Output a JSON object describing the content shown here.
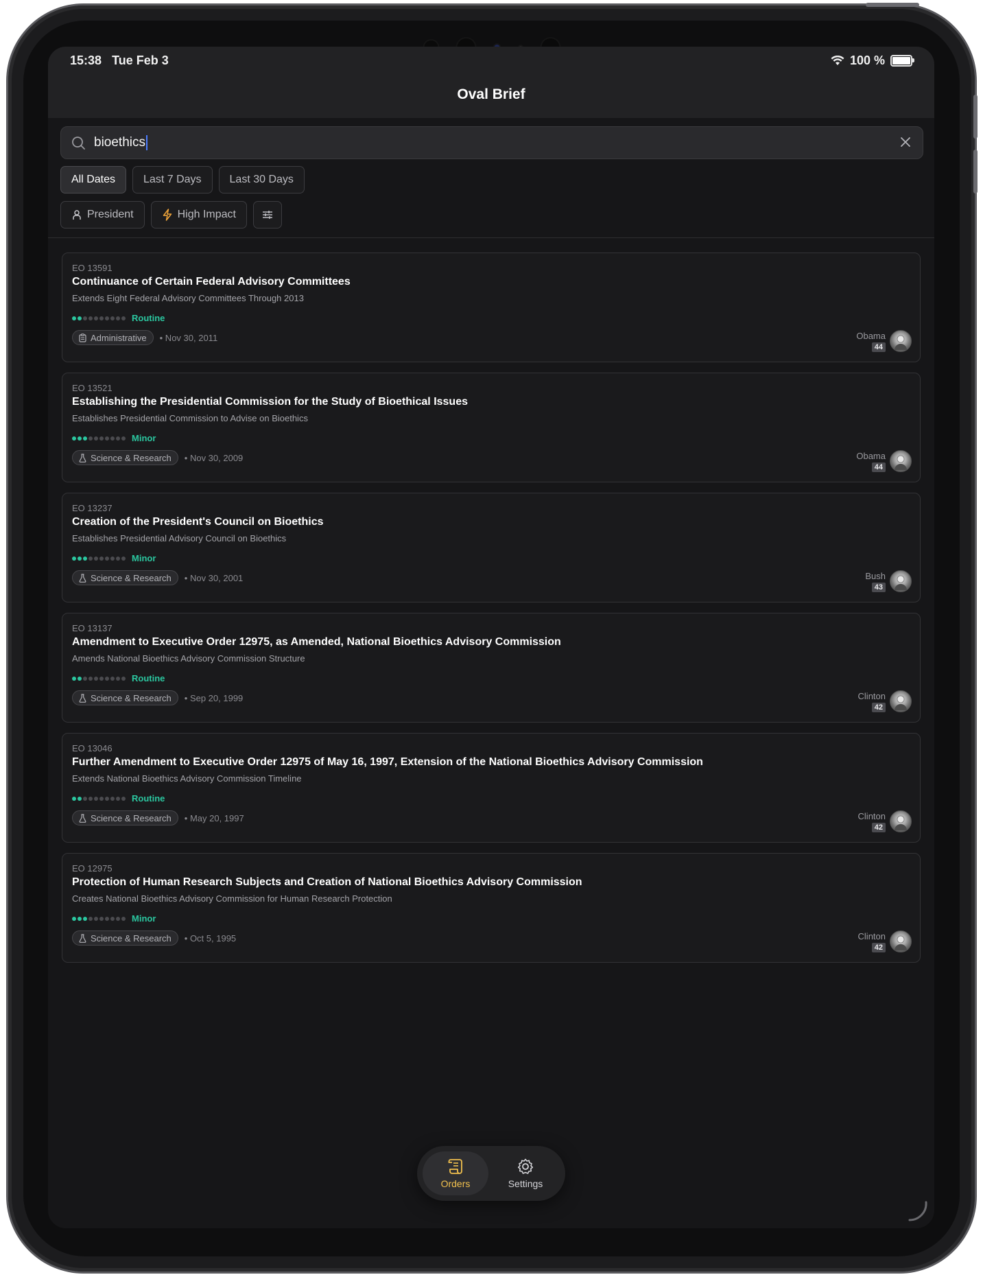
{
  "status": {
    "time": "15:38",
    "date": "Tue Feb 3",
    "battery": "100 %"
  },
  "app": {
    "title": "Oval Brief"
  },
  "search": {
    "value": "bioethics"
  },
  "date_filters": [
    {
      "label": "All Dates",
      "active": true
    },
    {
      "label": "Last 7 Days",
      "active": false
    },
    {
      "label": "Last 30 Days",
      "active": false
    }
  ],
  "filters": {
    "president": "President",
    "high_impact": "High Impact"
  },
  "orders": [
    {
      "eo": "EO 13591",
      "title": "Continuance of Certain Federal Advisory Committees",
      "subtitle": "Extends Eight Federal Advisory Committees Through 2013",
      "impact_level": 2,
      "impact_label": "Routine",
      "category": "Administrative",
      "date": "• Nov 30, 2011",
      "president": "Obama",
      "president_number": "44"
    },
    {
      "eo": "EO 13521",
      "title": "Establishing the Presidential Commission for the Study of Bioethical Issues",
      "subtitle": "Establishes Presidential Commission to Advise on Bioethics",
      "impact_level": 3,
      "impact_label": "Minor",
      "category": "Science & Research",
      "date": "• Nov 30, 2009",
      "president": "Obama",
      "president_number": "44"
    },
    {
      "eo": "EO 13237",
      "title": "Creation of the President's Council on Bioethics",
      "subtitle": "Establishes Presidential Advisory Council on Bioethics",
      "impact_level": 3,
      "impact_label": "Minor",
      "category": "Science & Research",
      "date": "• Nov 30, 2001",
      "president": "Bush",
      "president_number": "43"
    },
    {
      "eo": "EO 13137",
      "title": "Amendment to Executive Order 12975, as Amended, National Bioethics Advisory Commission",
      "subtitle": "Amends National Bioethics Advisory Commission Structure",
      "impact_level": 2,
      "impact_label": "Routine",
      "category": "Science & Research",
      "date": "• Sep 20, 1999",
      "president": "Clinton",
      "president_number": "42"
    },
    {
      "eo": "EO 13046",
      "title": "Further Amendment to Executive Order 12975 of May 16, 1997, Extension of the National Bioethics Advisory Commission",
      "subtitle": "Extends National Bioethics Advisory Commission Timeline",
      "impact_level": 2,
      "impact_label": "Routine",
      "category": "Science & Research",
      "date": "• May 20, 1997",
      "president": "Clinton",
      "president_number": "42"
    },
    {
      "eo": "EO 12975",
      "title": "Protection of Human Research Subjects and Creation of National Bioethics Advisory Commission",
      "subtitle": "Creates National Bioethics Advisory Commission for Human Research Protection",
      "impact_level": 3,
      "impact_label": "Minor",
      "category": "Science & Research",
      "date": "• Oct 5, 1995",
      "president": "Clinton",
      "president_number": "42"
    }
  ],
  "tabs": {
    "orders": "Orders",
    "settings": "Settings"
  },
  "colors": {
    "accent": "#f2c14e",
    "impact": "#2bc7a0",
    "high_impact_icon": "#f2a63a",
    "caret": "#4a7cff"
  },
  "icons": [
    "search-icon",
    "close-icon",
    "person-icon",
    "bolt-icon",
    "sliders-icon",
    "clipboard-icon",
    "flask-icon",
    "scroll-icon",
    "gear-icon",
    "wifi-icon",
    "battery-icon"
  ]
}
